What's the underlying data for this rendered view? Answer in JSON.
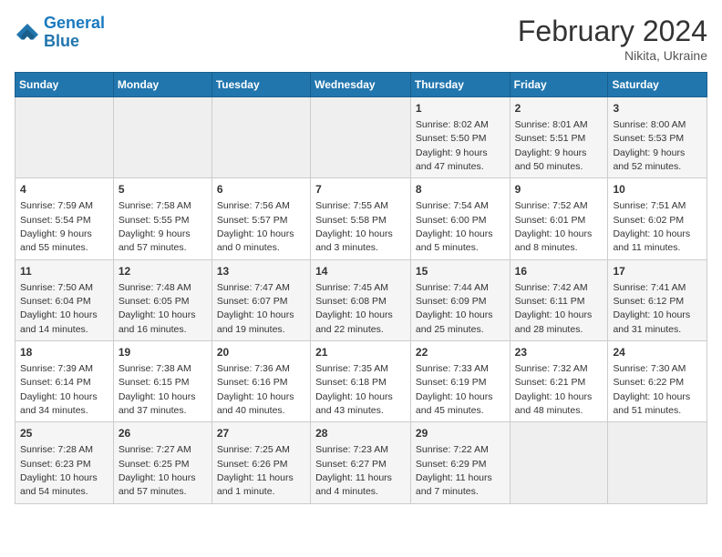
{
  "header": {
    "logo_line1": "General",
    "logo_line2": "Blue",
    "month": "February 2024",
    "location": "Nikita, Ukraine"
  },
  "days_of_week": [
    "Sunday",
    "Monday",
    "Tuesday",
    "Wednesday",
    "Thursday",
    "Friday",
    "Saturday"
  ],
  "weeks": [
    [
      {
        "day": "",
        "info": ""
      },
      {
        "day": "",
        "info": ""
      },
      {
        "day": "",
        "info": ""
      },
      {
        "day": "",
        "info": ""
      },
      {
        "day": "1",
        "info": "Sunrise: 8:02 AM\nSunset: 5:50 PM\nDaylight: 9 hours and 47 minutes."
      },
      {
        "day": "2",
        "info": "Sunrise: 8:01 AM\nSunset: 5:51 PM\nDaylight: 9 hours and 50 minutes."
      },
      {
        "day": "3",
        "info": "Sunrise: 8:00 AM\nSunset: 5:53 PM\nDaylight: 9 hours and 52 minutes."
      }
    ],
    [
      {
        "day": "4",
        "info": "Sunrise: 7:59 AM\nSunset: 5:54 PM\nDaylight: 9 hours and 55 minutes."
      },
      {
        "day": "5",
        "info": "Sunrise: 7:58 AM\nSunset: 5:55 PM\nDaylight: 9 hours and 57 minutes."
      },
      {
        "day": "6",
        "info": "Sunrise: 7:56 AM\nSunset: 5:57 PM\nDaylight: 10 hours and 0 minutes."
      },
      {
        "day": "7",
        "info": "Sunrise: 7:55 AM\nSunset: 5:58 PM\nDaylight: 10 hours and 3 minutes."
      },
      {
        "day": "8",
        "info": "Sunrise: 7:54 AM\nSunset: 6:00 PM\nDaylight: 10 hours and 5 minutes."
      },
      {
        "day": "9",
        "info": "Sunrise: 7:52 AM\nSunset: 6:01 PM\nDaylight: 10 hours and 8 minutes."
      },
      {
        "day": "10",
        "info": "Sunrise: 7:51 AM\nSunset: 6:02 PM\nDaylight: 10 hours and 11 minutes."
      }
    ],
    [
      {
        "day": "11",
        "info": "Sunrise: 7:50 AM\nSunset: 6:04 PM\nDaylight: 10 hours and 14 minutes."
      },
      {
        "day": "12",
        "info": "Sunrise: 7:48 AM\nSunset: 6:05 PM\nDaylight: 10 hours and 16 minutes."
      },
      {
        "day": "13",
        "info": "Sunrise: 7:47 AM\nSunset: 6:07 PM\nDaylight: 10 hours and 19 minutes."
      },
      {
        "day": "14",
        "info": "Sunrise: 7:45 AM\nSunset: 6:08 PM\nDaylight: 10 hours and 22 minutes."
      },
      {
        "day": "15",
        "info": "Sunrise: 7:44 AM\nSunset: 6:09 PM\nDaylight: 10 hours and 25 minutes."
      },
      {
        "day": "16",
        "info": "Sunrise: 7:42 AM\nSunset: 6:11 PM\nDaylight: 10 hours and 28 minutes."
      },
      {
        "day": "17",
        "info": "Sunrise: 7:41 AM\nSunset: 6:12 PM\nDaylight: 10 hours and 31 minutes."
      }
    ],
    [
      {
        "day": "18",
        "info": "Sunrise: 7:39 AM\nSunset: 6:14 PM\nDaylight: 10 hours and 34 minutes."
      },
      {
        "day": "19",
        "info": "Sunrise: 7:38 AM\nSunset: 6:15 PM\nDaylight: 10 hours and 37 minutes."
      },
      {
        "day": "20",
        "info": "Sunrise: 7:36 AM\nSunset: 6:16 PM\nDaylight: 10 hours and 40 minutes."
      },
      {
        "day": "21",
        "info": "Sunrise: 7:35 AM\nSunset: 6:18 PM\nDaylight: 10 hours and 43 minutes."
      },
      {
        "day": "22",
        "info": "Sunrise: 7:33 AM\nSunset: 6:19 PM\nDaylight: 10 hours and 45 minutes."
      },
      {
        "day": "23",
        "info": "Sunrise: 7:32 AM\nSunset: 6:21 PM\nDaylight: 10 hours and 48 minutes."
      },
      {
        "day": "24",
        "info": "Sunrise: 7:30 AM\nSunset: 6:22 PM\nDaylight: 10 hours and 51 minutes."
      }
    ],
    [
      {
        "day": "25",
        "info": "Sunrise: 7:28 AM\nSunset: 6:23 PM\nDaylight: 10 hours and 54 minutes."
      },
      {
        "day": "26",
        "info": "Sunrise: 7:27 AM\nSunset: 6:25 PM\nDaylight: 10 hours and 57 minutes."
      },
      {
        "day": "27",
        "info": "Sunrise: 7:25 AM\nSunset: 6:26 PM\nDaylight: 11 hours and 1 minute."
      },
      {
        "day": "28",
        "info": "Sunrise: 7:23 AM\nSunset: 6:27 PM\nDaylight: 11 hours and 4 minutes."
      },
      {
        "day": "29",
        "info": "Sunrise: 7:22 AM\nSunset: 6:29 PM\nDaylight: 11 hours and 7 minutes."
      },
      {
        "day": "",
        "info": ""
      },
      {
        "day": "",
        "info": ""
      }
    ]
  ]
}
